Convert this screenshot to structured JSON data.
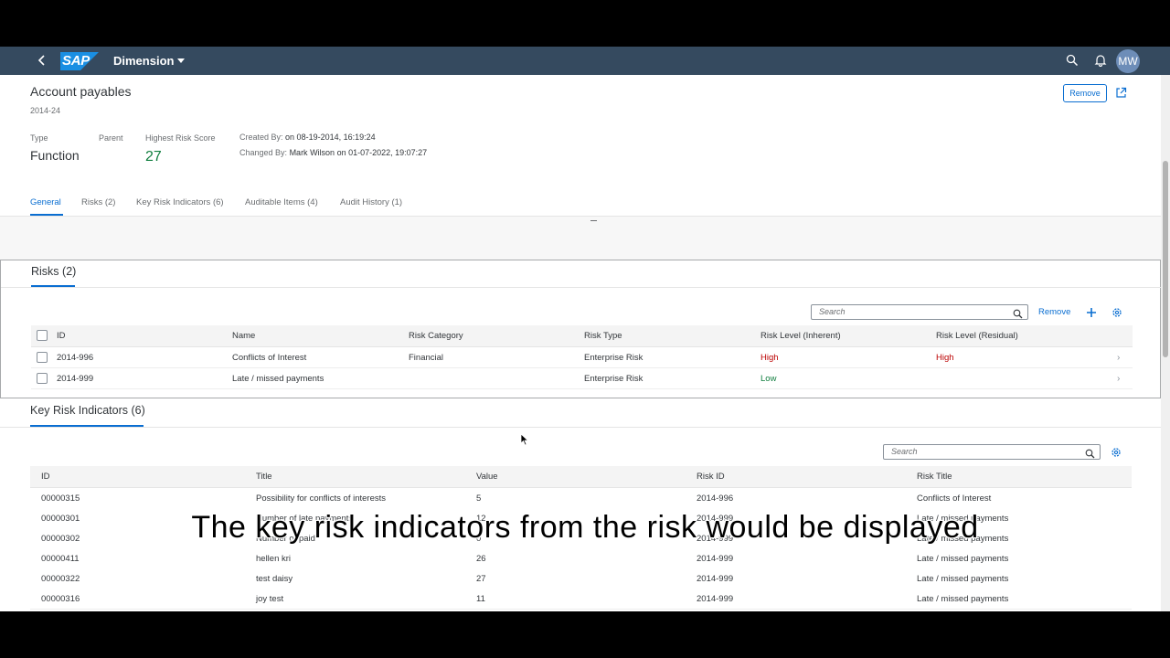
{
  "shell": {
    "logo": "SAP",
    "product": "Dimension",
    "avatar_initials": "MW"
  },
  "header": {
    "title": "Account payables",
    "subtitle": "2014-24",
    "remove_label": "Remove",
    "attributes": {
      "type_label": "Type",
      "type_value": "Function",
      "parent_label": "Parent",
      "score_label": "Highest Risk Score",
      "score_value": "27"
    },
    "created_label": "Created By:",
    "created_value": "on 08-19-2014, 16:19:24",
    "changed_label": "Changed By:",
    "changed_value": "Mark Wilson on 01-07-2022, 19:07:27"
  },
  "tabs": [
    {
      "label": "General"
    },
    {
      "label": "Risks (2)"
    },
    {
      "label": "Key Risk Indicators (6)"
    },
    {
      "label": "Auditable Items (4)"
    },
    {
      "label": "Audit History (1)"
    }
  ],
  "risks": {
    "title": "Risks (2)",
    "search_placeholder": "Search",
    "remove_label": "Remove",
    "columns": [
      "ID",
      "Name",
      "Risk Category",
      "Risk Type",
      "Risk Level (Inherent)",
      "Risk Level (Residual)"
    ],
    "rows": [
      {
        "id": "2014-996",
        "name": "Conflicts of Interest",
        "category": "Financial",
        "type": "Enterprise Risk",
        "inherent": "High",
        "residual": "High"
      },
      {
        "id": "2014-999",
        "name": "Late / missed payments",
        "category": "",
        "type": "Enterprise Risk",
        "inherent": "Low",
        "residual": ""
      }
    ]
  },
  "kri": {
    "title": "Key Risk Indicators (6)",
    "search_placeholder": "Search",
    "columns": [
      "ID",
      "Title",
      "Value",
      "Risk ID",
      "Risk Title"
    ],
    "rows": [
      {
        "id": "00000315",
        "title": "Possibility for conflicts of interests",
        "value": "5",
        "risk_id": "2014-996",
        "risk_title": "Conflicts of Interest"
      },
      {
        "id": "00000301",
        "title": "Number of late payments",
        "value": "12",
        "risk_id": "2014-999",
        "risk_title": "Late / missed payments"
      },
      {
        "id": "00000302",
        "title": "Number of paid",
        "value": "0",
        "risk_id": "2014-999",
        "risk_title": "Late / missed payments"
      },
      {
        "id": "00000411",
        "title": "hellen kri",
        "value": "26",
        "risk_id": "2014-999",
        "risk_title": "Late / missed payments"
      },
      {
        "id": "00000322",
        "title": "test daisy",
        "value": "27",
        "risk_id": "2014-999",
        "risk_title": "Late / missed payments"
      },
      {
        "id": "00000316",
        "title": "joy test",
        "value": "11",
        "risk_id": "2014-999",
        "risk_title": "Late / missed payments"
      }
    ]
  },
  "caption": "The key risk indicators from the risk would be displayed",
  "colors": {
    "shell": "#354a5f",
    "accent": "#0a6ed1",
    "positive": "#107e3e",
    "negative": "#bb0000"
  },
  "icons": [
    "back-icon",
    "search-icon",
    "bell-icon",
    "share-icon",
    "add-icon",
    "settings-icon",
    "chevron-right-icon"
  ]
}
